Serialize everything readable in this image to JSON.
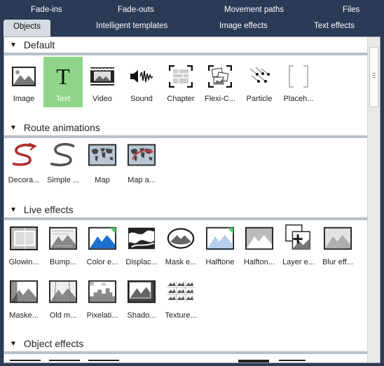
{
  "tabs_row1": [
    {
      "label": "Fade-ins",
      "id": "fade-ins"
    },
    {
      "label": "Fade-outs",
      "id": "fade-outs"
    },
    {
      "label": "Movement paths",
      "id": "movement-paths"
    },
    {
      "label": "Files",
      "id": "files"
    }
  ],
  "tabs_row2": [
    {
      "label": "Objects",
      "id": "objects",
      "active": true
    },
    {
      "label": "Intelligent templates",
      "id": "intelligent-templates"
    },
    {
      "label": "Image effects",
      "id": "image-effects"
    },
    {
      "label": "Text effects",
      "id": "text-effects"
    }
  ],
  "sections": [
    {
      "title": "Default",
      "items": [
        {
          "label": "Image",
          "icon": "image-icon"
        },
        {
          "label": "Text",
          "icon": "text-icon",
          "selected": true
        },
        {
          "label": "Video",
          "icon": "video-icon"
        },
        {
          "label": "Sound",
          "icon": "sound-icon"
        },
        {
          "label": "Chapter",
          "icon": "chapter-icon"
        },
        {
          "label": "Flexi-C...",
          "icon": "flexi-collage-icon"
        },
        {
          "label": "Particle",
          "icon": "particle-icon"
        },
        {
          "label": "Placeh...",
          "icon": "placeholder-icon"
        }
      ]
    },
    {
      "title": "Route animations",
      "items": [
        {
          "label": "Decora...",
          "icon": "decorative-route-icon"
        },
        {
          "label": "Simple ...",
          "icon": "simple-route-icon"
        },
        {
          "label": "Map",
          "icon": "map-icon"
        },
        {
          "label": "Map a...",
          "icon": "map-animation-icon"
        }
      ]
    },
    {
      "title": "Live effects",
      "items": [
        {
          "label": "Glowin...",
          "icon": "glowing-icon"
        },
        {
          "label": "Bump...",
          "icon": "bump-icon"
        },
        {
          "label": "Color e...",
          "icon": "color-effect-icon"
        },
        {
          "label": "Displac...",
          "icon": "displacement-icon"
        },
        {
          "label": "Mask e...",
          "icon": "mask-effect-icon"
        },
        {
          "label": "Halftone",
          "icon": "halftone-icon"
        },
        {
          "label": "Halfton...",
          "icon": "halftone-bw-icon"
        },
        {
          "label": "Layer e...",
          "icon": "layer-effect-icon"
        },
        {
          "label": "Blur eff...",
          "icon": "blur-effect-icon"
        },
        {
          "label": "Maske...",
          "icon": "masked-icon"
        },
        {
          "label": "Old m...",
          "icon": "old-movie-icon"
        },
        {
          "label": "Pixelati...",
          "icon": "pixelation-icon"
        },
        {
          "label": "Shado...",
          "icon": "shadow-icon"
        },
        {
          "label": "Texture...",
          "icon": "texture-icon"
        }
      ]
    },
    {
      "title": "Object effects",
      "items": []
    }
  ],
  "colors": {
    "window_bg": "#2b3a55",
    "active_tab_bg": "#d6dbe2",
    "selected_item_bg": "#8fd68a",
    "section_rule": "#b9c0c8",
    "route_red": "#c0393b",
    "halftone_blue": "#1f6fd0"
  }
}
